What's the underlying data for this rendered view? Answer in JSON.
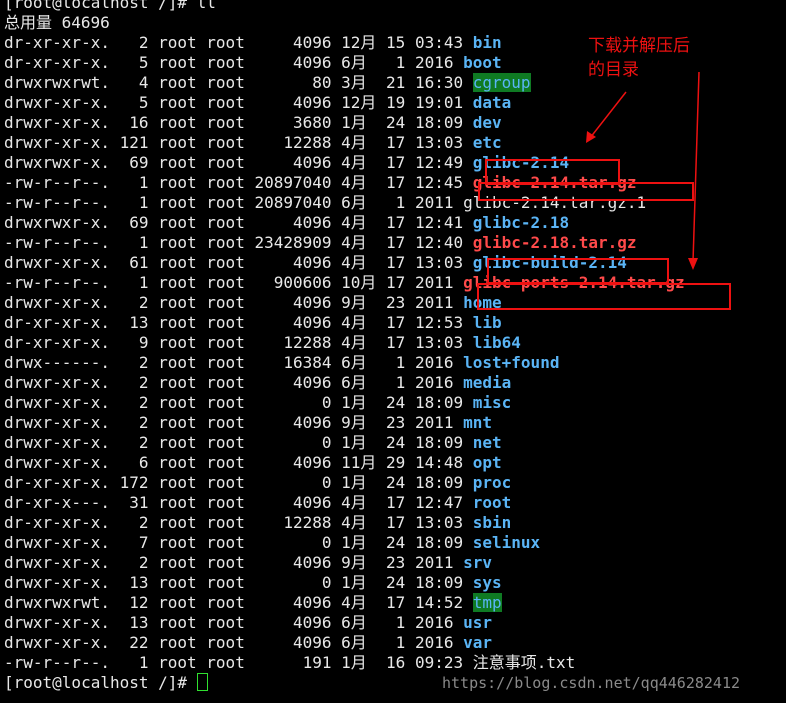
{
  "prompt_top": "[root@localhost /]# ll",
  "total": "总用量 64696",
  "listing": [
    {
      "meta": "dr-xr-xr-x.   2 root root     4096 12月 15 03:43 ",
      "name": "bin",
      "kind": "dir"
    },
    {
      "meta": "dr-xr-xr-x.   5 root root     4096 6月   1 2016 ",
      "name": "boot",
      "kind": "dir"
    },
    {
      "meta": "drwxrwxrwt.   4 root root       80 3月  21 16:30 ",
      "name": "cgroup",
      "kind": "hl"
    },
    {
      "meta": "drwxr-xr-x.   5 root root     4096 12月 19 19:01 ",
      "name": "data",
      "kind": "dir"
    },
    {
      "meta": "drwxr-xr-x.  16 root root     3680 1月  24 18:09 ",
      "name": "dev",
      "kind": "dir"
    },
    {
      "meta": "drwxr-xr-x. 121 root root    12288 4月  17 13:03 ",
      "name": "etc",
      "kind": "dir"
    },
    {
      "meta": "drwxrwxr-x.  69 root root     4096 4月  17 12:49 ",
      "name": "glibc-2.14",
      "kind": "dir"
    },
    {
      "meta": "-rw-r--r--.   1 root root 20897040 4月  17 12:45 ",
      "name": "glibc-2.14.tar.gz",
      "kind": "arc"
    },
    {
      "meta": "-rw-r--r--.   1 root root 20897040 6月   1 2011 ",
      "name": "glibc-2.14.tar.gz.1",
      "kind": "file"
    },
    {
      "meta": "drwxrwxr-x.  69 root root     4096 4月  17 12:41 ",
      "name": "glibc-2.18",
      "kind": "dir"
    },
    {
      "meta": "-rw-r--r--.   1 root root 23428909 4月  17 12:40 ",
      "name": "glibc-2.18.tar.gz",
      "kind": "arc"
    },
    {
      "meta": "drwxr-xr-x.  61 root root     4096 4月  17 13:03 ",
      "name": "glibc-build-2.14",
      "kind": "dir"
    },
    {
      "meta": "-rw-r--r--.   1 root root   900606 10月 17 2011 ",
      "name": "glibc-ports-2.14.tar.gz",
      "kind": "arc"
    },
    {
      "meta": "drwxr-xr-x.   2 root root     4096 9月  23 2011 ",
      "name": "home",
      "kind": "dir"
    },
    {
      "meta": "dr-xr-xr-x.  13 root root     4096 4月  17 12:53 ",
      "name": "lib",
      "kind": "dir"
    },
    {
      "meta": "dr-xr-xr-x.   9 root root    12288 4月  17 13:03 ",
      "name": "lib64",
      "kind": "dir"
    },
    {
      "meta": "drwx------.   2 root root    16384 6月   1 2016 ",
      "name": "lost+found",
      "kind": "dir"
    },
    {
      "meta": "drwxr-xr-x.   2 root root     4096 6月   1 2016 ",
      "name": "media",
      "kind": "dir"
    },
    {
      "meta": "drwxr-xr-x.   2 root root        0 1月  24 18:09 ",
      "name": "misc",
      "kind": "dir"
    },
    {
      "meta": "drwxr-xr-x.   2 root root     4096 9月  23 2011 ",
      "name": "mnt",
      "kind": "dir"
    },
    {
      "meta": "drwxr-xr-x.   2 root root        0 1月  24 18:09 ",
      "name": "net",
      "kind": "dir"
    },
    {
      "meta": "drwxr-xr-x.   6 root root     4096 11月 29 14:48 ",
      "name": "opt",
      "kind": "dir"
    },
    {
      "meta": "dr-xr-xr-x. 172 root root        0 1月  24 18:09 ",
      "name": "proc",
      "kind": "dir"
    },
    {
      "meta": "dr-xr-x---.  31 root root     4096 4月  17 12:47 ",
      "name": "root",
      "kind": "dir"
    },
    {
      "meta": "dr-xr-xr-x.   2 root root    12288 4月  17 13:03 ",
      "name": "sbin",
      "kind": "dir"
    },
    {
      "meta": "drwxr-xr-x.   7 root root        0 1月  24 18:09 ",
      "name": "selinux",
      "kind": "dir"
    },
    {
      "meta": "drwxr-xr-x.   2 root root     4096 9月  23 2011 ",
      "name": "srv",
      "kind": "dir"
    },
    {
      "meta": "drwxr-xr-x.  13 root root        0 1月  24 18:09 ",
      "name": "sys",
      "kind": "dir"
    },
    {
      "meta": "drwxrwxrwt.  12 root root     4096 4月  17 14:52 ",
      "name": "tmp",
      "kind": "hl"
    },
    {
      "meta": "drwxr-xr-x.  13 root root     4096 6月   1 2016 ",
      "name": "usr",
      "kind": "dir"
    },
    {
      "meta": "drwxr-xr-x.  22 root root     4096 6月   1 2016 ",
      "name": "var",
      "kind": "dir"
    },
    {
      "meta": "-rw-r--r--.   1 root root      191 1月  16 09:23 ",
      "name": "注意事项.txt",
      "kind": "file"
    }
  ],
  "prompt_bottom": "[root@localhost /]# ",
  "annotation": "下载并解压后\n的目录",
  "watermark": "https://blog.csdn.net/qq446282412",
  "colors": {
    "directory": "#5ab4f5",
    "archive": "#ff4a4a",
    "annotation": "#e11",
    "sticky_bg": "#0f7a23"
  }
}
